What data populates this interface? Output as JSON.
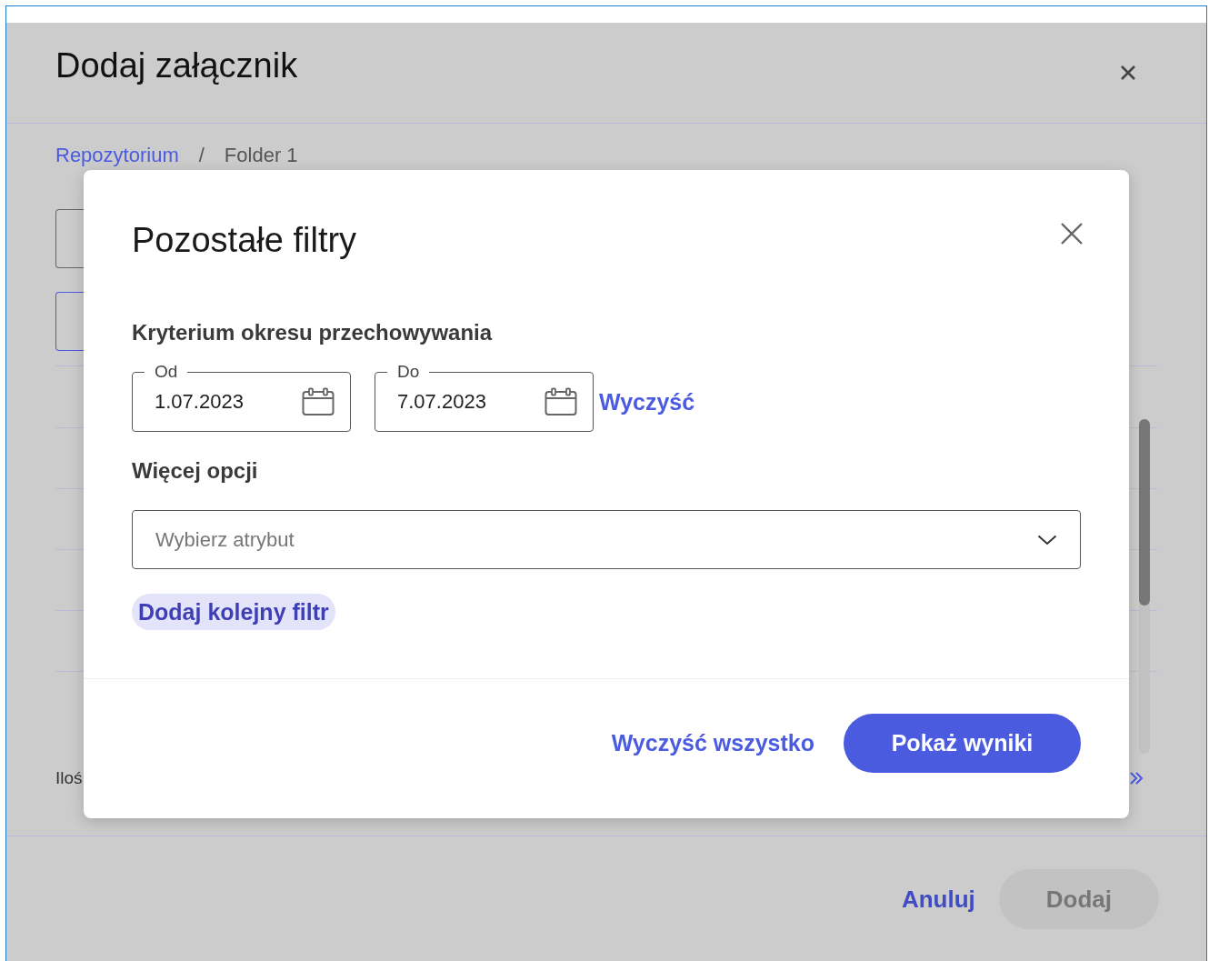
{
  "background_dialog": {
    "title": "Dodaj załącznik",
    "breadcrumb": [
      {
        "label": "Repozytorium",
        "kind": "link"
      },
      {
        "label": "Folder 1",
        "kind": "current"
      }
    ],
    "breadcrumb_separator": "/",
    "footer_text": "Iloś",
    "buttons": [
      {
        "label": "Anuluj",
        "kind": "text",
        "disabled": false
      },
      {
        "label": "Dodaj",
        "kind": "filled",
        "disabled": true
      }
    ]
  },
  "filter_dialog": {
    "title": "Pozostałe filtry",
    "retention": {
      "heading": "Kryterium okresu przechowywania",
      "from": {
        "label": "Od",
        "value": "1.07.2023"
      },
      "to": {
        "label": "Do",
        "value": "7.07.2023"
      },
      "clear": "Wyczyść"
    },
    "more_options": {
      "heading": "Więcej opcji",
      "select": {
        "placeholder": "Wybierz atrybut"
      }
    },
    "add_filter": "Dodaj kolejny filtr",
    "footer": {
      "clear_all": "Wyczyść wszystko",
      "submit": "Pokaż wyniki"
    }
  }
}
